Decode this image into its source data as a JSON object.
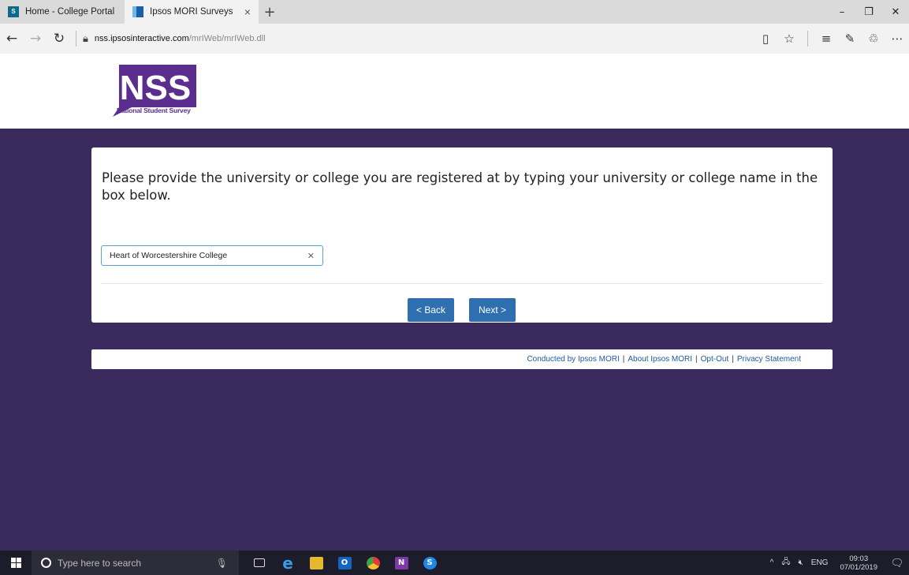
{
  "browser": {
    "tabs": [
      {
        "label": "Home - College Portal",
        "active": false
      },
      {
        "label": "Ipsos MORI Surveys",
        "active": true
      }
    ],
    "new_tab_symbol": "+",
    "close_symbol": "×",
    "window_controls": {
      "minimize": "–",
      "restore": "❐",
      "close": "✕"
    },
    "url_domain": "nss.ipsosinteractive.com",
    "url_path": "/mrIWeb/mrIWeb.dll"
  },
  "logo": {
    "text": "NSS",
    "tagline": "National Student Survey",
    "color": "#5b2d8e"
  },
  "survey": {
    "question": "Please provide the university or college you are registered at by typing your university or college name in the box below.",
    "answer_value": "Heart of Worcestershire College",
    "back_label": "< Back",
    "next_label": "Next >"
  },
  "footer": {
    "links": [
      "Conducted by Ipsos MORI",
      "About Ipsos MORI",
      "Opt-Out",
      "Privacy Statement"
    ],
    "separator": "|"
  },
  "taskbar": {
    "search_placeholder": "Type here to search",
    "language": "ENG",
    "time": "09:03",
    "date": "07/01/2019"
  },
  "colors": {
    "page_bg": "#3a2a5e",
    "button": "#2f6fb0",
    "link": "#1f5aa0"
  }
}
